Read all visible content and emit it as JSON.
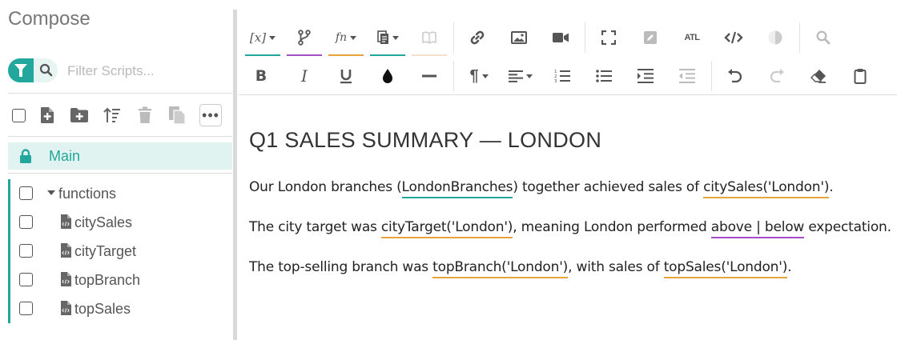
{
  "app": {
    "title": "Compose"
  },
  "filter": {
    "placeholder": "Filter Scripts..."
  },
  "tree": {
    "main_label": "Main",
    "folder_label": "functions",
    "files": [
      "citySales",
      "cityTarget",
      "topBranch",
      "topSales"
    ]
  },
  "document": {
    "heading": "Q1 SALES SUMMARY — LONDON",
    "p1": {
      "t1": "Our London branches (",
      "var": "LondonBranches",
      "t2": ") together achieved sales of ",
      "fn": "citySales('London')",
      "t3": "."
    },
    "p2": {
      "t1": "The city target was ",
      "fn": "cityTarget('London')",
      "t2": ", meaning London performed ",
      "cond": "above | below",
      "t3": " expectation."
    },
    "p3": {
      "t1": "The top-selling branch was ",
      "fn1": "topBranch('London')",
      "t2": ", with sales of ",
      "fn2": "topSales('London')",
      "t3": "."
    }
  },
  "colors": {
    "accent": "#23a79c",
    "variable": "#23a79c",
    "function": "#e8a33d",
    "condition": "#a24fc8"
  },
  "icons": {
    "toolbar1": [
      "variable-icon",
      "branch-icon",
      "function-icon",
      "snippet-icon",
      "book-icon",
      "link-icon",
      "image-icon",
      "video-icon",
      "fullscreen-icon",
      "edit-icon",
      "atl-icon",
      "code-icon",
      "contrast-icon",
      "search-icon"
    ],
    "toolbar2": [
      "bold-icon",
      "italic-icon",
      "underline-icon",
      "color-drop-icon",
      "horizontal-rule-icon",
      "paragraph-icon",
      "align-left-icon",
      "ordered-list-icon",
      "bullet-list-icon",
      "indent-icon",
      "outdent-icon",
      "undo-icon",
      "redo-icon",
      "eraser-icon",
      "clipboard-icon"
    ]
  },
  "toolbar_text": {
    "atl": "ATL"
  }
}
